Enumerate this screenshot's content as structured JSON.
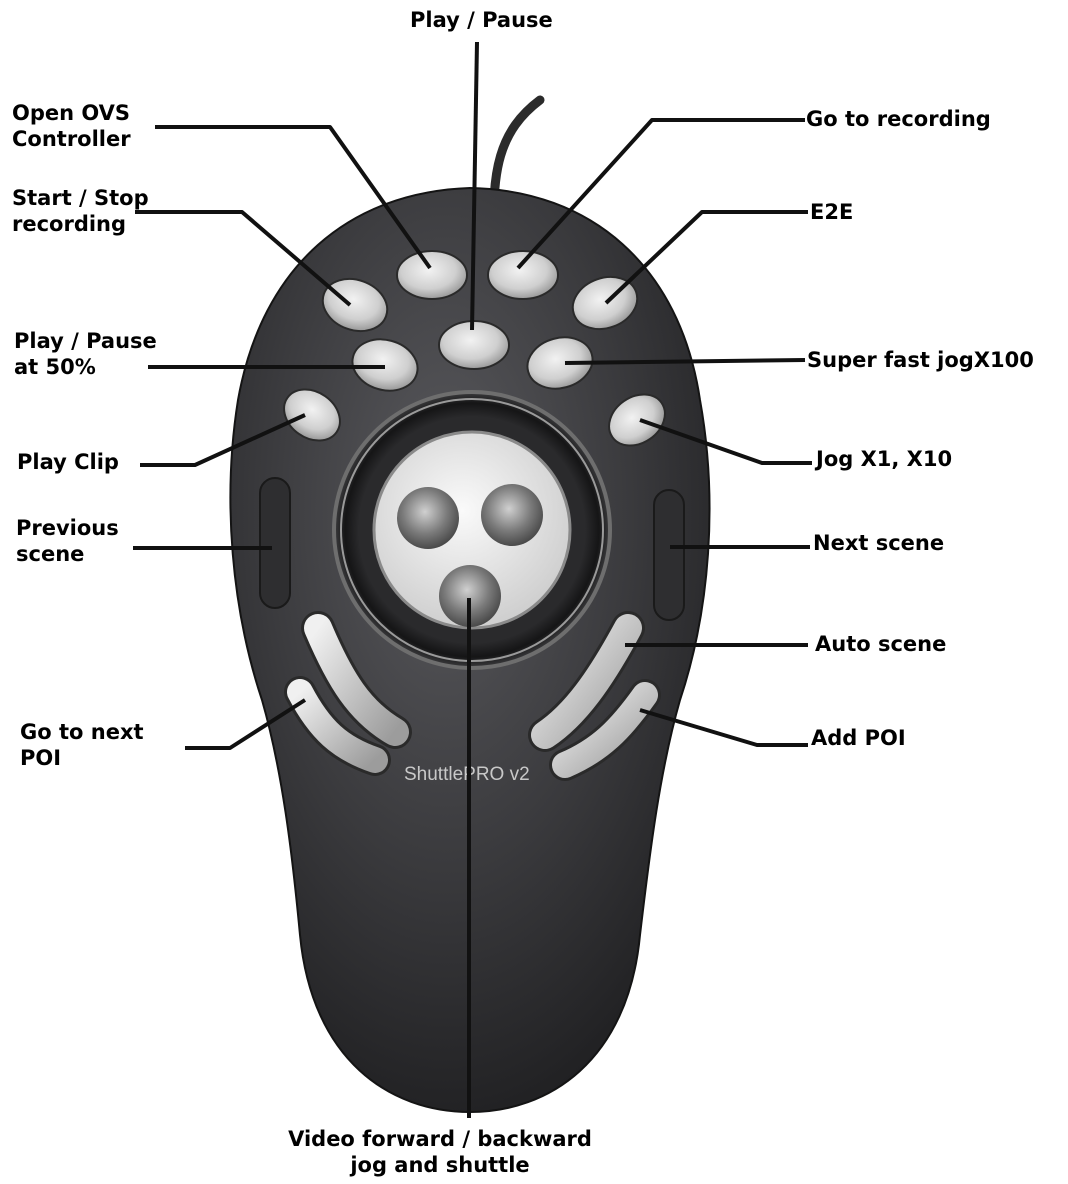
{
  "device": {
    "brand": "ShuttlePRO v2",
    "colors": {
      "body": "#3a3a3c",
      "button": "#d6d6d6",
      "ring": "#9a9a9a",
      "center_disc": "#e9e9e9",
      "leader": "#1a1a1a"
    }
  },
  "labels": {
    "play_pause": "Play / Pause",
    "open_ovs_1": "Open OVS",
    "open_ovs_2": "Controller",
    "go_to_recording": "Go to recording",
    "start_stop_1": "Start / Stop",
    "start_stop_2": "recording",
    "e2e": "E2E",
    "play_pause_50_1": "Play / Pause",
    "play_pause_50_2": "at 50%",
    "super_fast_jog": "Super fast jogX100",
    "play_clip": "Play Clip",
    "jog_x1_x10": "Jog X1, X10",
    "previous_scene_1": "Previous",
    "previous_scene_2": "scene",
    "next_scene": "Next scene",
    "auto_scene": "Auto scene",
    "go_to_next_poi_1": "Go to next",
    "go_to_next_poi_2": "POI",
    "add_poi": "Add POI",
    "video_forward_1": "Video forward / backward",
    "video_forward_2": "jog and shuttle"
  }
}
